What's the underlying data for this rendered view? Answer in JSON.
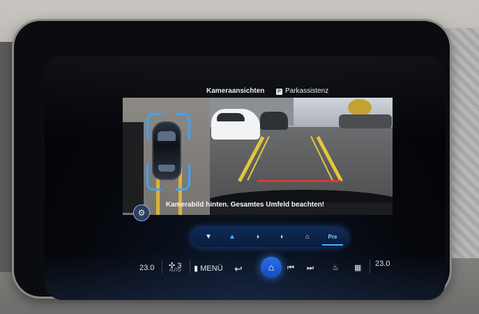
{
  "tabs": {
    "camera_views": "Kameraansichten",
    "parking_assist": "Parkassistenz",
    "parking_assist_icon_letter": "P"
  },
  "hint": "Kamerabild hinten. Gesamtes Umfeld beachten!",
  "view_bar": {
    "buttons": [
      {
        "icon": "car-front-icon",
        "glyph": "▼"
      },
      {
        "icon": "car-rear-icon",
        "glyph": "▲",
        "active": true
      },
      {
        "icon": "wheel-left-icon",
        "glyph": "◑"
      },
      {
        "icon": "wheel-right-icon",
        "glyph": "◐"
      },
      {
        "icon": "car-side-icon",
        "glyph": "⌂"
      }
    ],
    "pre_label": "Pre"
  },
  "bottom": {
    "temp_left": "23.0",
    "fan_level": "3",
    "fan_mode": "AUTO",
    "menu": "MENÜ",
    "temp_right": "23.0"
  },
  "colors": {
    "accent": "#3fa9ff",
    "guide_yellow": "#e7c53a",
    "guide_red": "#d63b2b"
  }
}
